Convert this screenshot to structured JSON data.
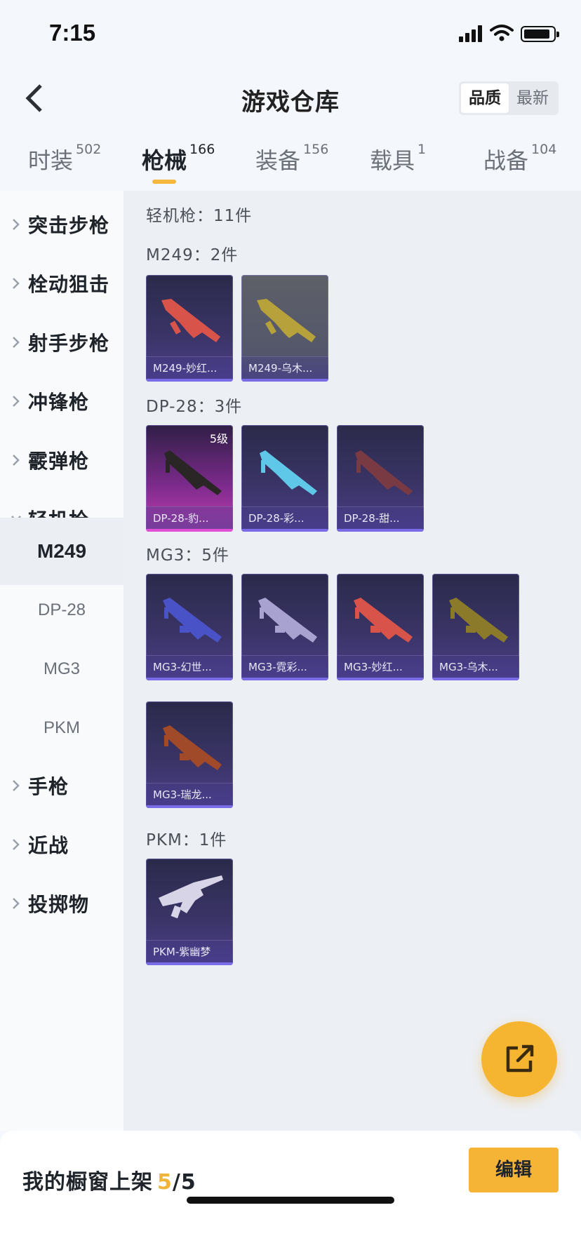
{
  "status": {
    "time": "7:15"
  },
  "nav": {
    "title": "游戏仓库"
  },
  "sort": {
    "options": [
      "品质",
      "最新"
    ],
    "active": 0
  },
  "tabs": [
    {
      "label": "时装",
      "count": "502"
    },
    {
      "label": "枪械",
      "count": "166"
    },
    {
      "label": "装备",
      "count": "156"
    },
    {
      "label": "载具",
      "count": "1"
    },
    {
      "label": "战备",
      "count": "104"
    }
  ],
  "active_tab": 1,
  "sidebar": {
    "categories": [
      "突击步枪",
      "栓动狙击",
      "射手步枪",
      "冲锋枪",
      "霰弹枪",
      "轻机枪",
      "手枪",
      "近战",
      "投掷物"
    ],
    "expanded_category": "轻机枪",
    "subitems": [
      "M249",
      "DP-28",
      "MG3",
      "PKM"
    ],
    "active_subitem": "M249"
  },
  "content": {
    "header": "轻机枪：11件",
    "groups": [
      {
        "title": "M249：2件",
        "items": [
          {
            "caption": "M249-妙红...",
            "style": "purple",
            "gun_color": "#d8544a"
          },
          {
            "caption": "M249-乌木...",
            "style": "gray",
            "gun_color": "#b6a13a"
          }
        ]
      },
      {
        "title": "DP-28：3件",
        "items": [
          {
            "caption": "DP-28-豹...",
            "style": "pink",
            "badge": "5级",
            "gun_color": "#2a2626"
          },
          {
            "caption": "DP-28-彩...",
            "style": "purple",
            "gun_color": "#5fc8e8"
          },
          {
            "caption": "DP-28-甜...",
            "style": "purple",
            "gun_color": "#7a3a44"
          }
        ]
      },
      {
        "title": "MG3：5件",
        "items": [
          {
            "caption": "MG3-幻世...",
            "style": "purple",
            "gun_color": "#4a52c8"
          },
          {
            "caption": "MG3-霓彩...",
            "style": "purple",
            "gun_color": "#a8a2d0"
          },
          {
            "caption": "MG3-妙红...",
            "style": "purple",
            "gun_color": "#d8544a"
          },
          {
            "caption": "MG3-乌木...",
            "style": "purple",
            "gun_color": "#8a7a2a"
          },
          {
            "caption": "MG3-瑞龙...",
            "style": "purple",
            "gun_color": "#a04a2a"
          }
        ]
      },
      {
        "title": "PKM：1件",
        "items": [
          {
            "caption": "PKM-紫幽梦",
            "style": "purple",
            "gun_color": "#d8d4e8"
          }
        ]
      }
    ]
  },
  "bottom": {
    "shelf_label": "我的橱窗上架",
    "shelf_current": "5",
    "shelf_separator": "/",
    "shelf_total": "5",
    "edit_label": "编辑"
  },
  "colors": {
    "accent": "#f5b435",
    "card_purple": "#3a3466",
    "card_pink": "#c33fb4"
  },
  "icons": {
    "back": "chevron-left-icon",
    "fab": "share-external-icon"
  }
}
